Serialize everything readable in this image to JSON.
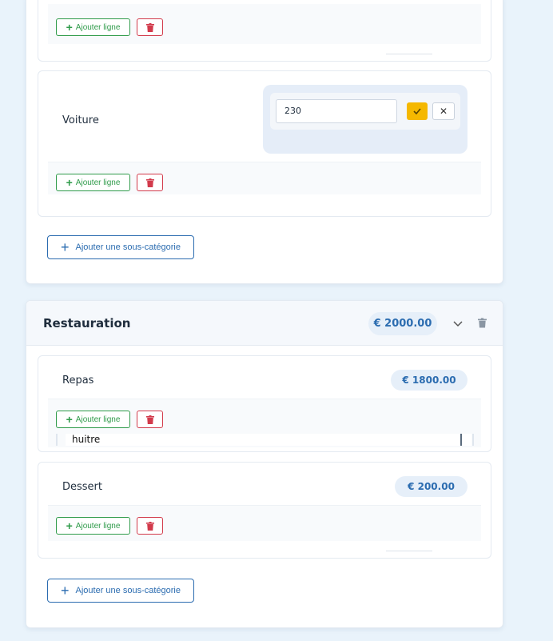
{
  "common": {
    "add_line_label": "Ajouter ligne",
    "add_subcategory_label": "Ajouter une sous-catégorie",
    "plus_glyph": "+"
  },
  "top_category": {
    "subcategories": [
      {
        "name": ""
      },
      {
        "name": "Voiture",
        "edit": {
          "value": "230",
          "confirm_icon": "check-icon",
          "cancel_glyph": "✕"
        }
      }
    ]
  },
  "restauration": {
    "title": "Restauration",
    "total": "€ 2000.00",
    "subcategories": [
      {
        "name": "Repas",
        "amount": "€ 1800.00",
        "line_input_value": "huitre"
      },
      {
        "name": "Dessert",
        "amount": "€ 200.00"
      }
    ]
  },
  "colors": {
    "accent_blue": "#2b6cb0",
    "add_green": "#2f9b4a",
    "delete_red": "#d23a4b",
    "confirm_yellow": "#f5b800",
    "background": "#e9f3fb"
  }
}
